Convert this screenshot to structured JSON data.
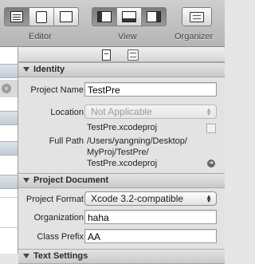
{
  "toolbar": {
    "editor_label": "Editor",
    "view_label": "View",
    "organizer_label": "Organizer"
  },
  "inspector": {
    "identity": {
      "header": "Identity",
      "project_name_label": "Project Name",
      "project_name_value": "TestPre",
      "location_label": "Location",
      "location_value": "Not Applicable",
      "full_path_label": "Full Path",
      "file_name": "TestPre.xcodeproj",
      "path_line1": "/Users/yangning/Desktop/",
      "path_line2": "MyProj/TestPre/",
      "path_line3": "TestPre.xcodeproj"
    },
    "project_document": {
      "header": "Project Document",
      "project_format_label": "Project Format",
      "project_format_value": "Xcode 3.2-compatible",
      "organization_label": "Organization",
      "organization_value": "haha",
      "class_prefix_label": "Class Prefix",
      "class_prefix_value": "AA"
    },
    "text_settings": {
      "header": "Text Settings"
    }
  }
}
